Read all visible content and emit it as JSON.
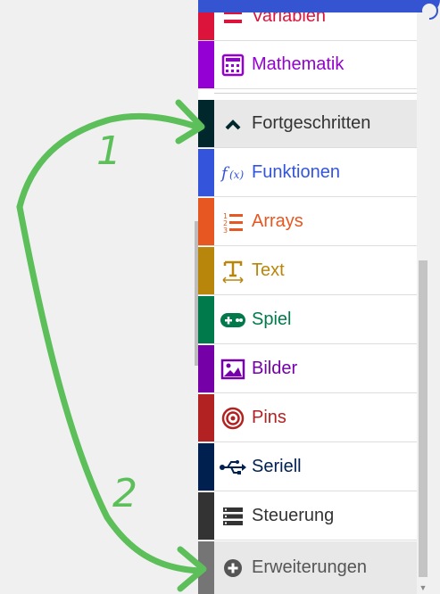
{
  "categories": [
    {
      "label": "Variablen",
      "color": "#dc143c",
      "icon": "variables-icon"
    },
    {
      "label": "Mathematik",
      "color": "#9400d3",
      "icon": "calculator-icon"
    },
    {
      "label": "Fortgeschritten",
      "color": "#00272b",
      "icon": "chevron-up-icon"
    },
    {
      "label": "Funktionen",
      "color": "#3455db",
      "icon": "function-icon"
    },
    {
      "label": "Arrays",
      "color": "#e65722",
      "icon": "ordered-list-icon"
    },
    {
      "label": "Text",
      "color": "#b8860b",
      "icon": "text-icon"
    },
    {
      "label": "Spiel",
      "color": "#007a4b",
      "icon": "gamepad-icon"
    },
    {
      "label": "Bilder",
      "color": "#7600a8",
      "icon": "image-icon"
    },
    {
      "label": "Pins",
      "color": "#b22222",
      "icon": "target-icon"
    },
    {
      "label": "Seriell",
      "color": "#002050",
      "icon": "usb-icon"
    },
    {
      "label": "Steuerung",
      "color": "#333333",
      "icon": "server-icon"
    },
    {
      "label": "Erweiterungen",
      "color": "#757575",
      "icon": "plus-circle-icon"
    }
  ],
  "annotations": {
    "one": "1",
    "two": "2"
  }
}
